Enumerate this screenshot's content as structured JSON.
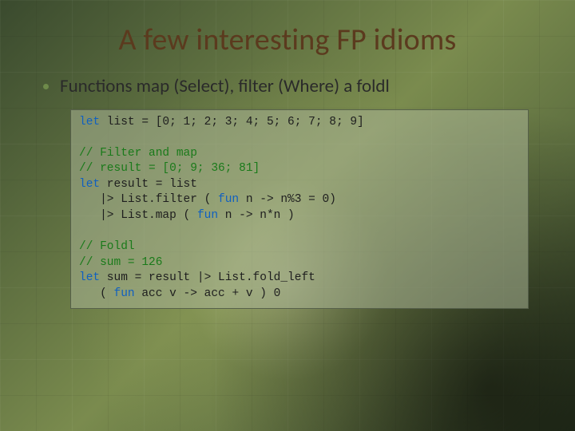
{
  "title": "A few interesting FP idioms",
  "bullet": "Functions map (Select), filter (Where) a foldl",
  "code": {
    "l1_pre": "let",
    "l1_post": " list = [0; 1; 2; 3; 4; 5; 6; 7; 8; 9]",
    "c1": "// Filter and map",
    "c2": "// result = [0; 9; 36; 81]",
    "l2_pre": "let",
    "l2_post": " result = list",
    "l3a": "   |> List.filter ( ",
    "l3b": "fun",
    "l3c": " n -> n%3 = 0)",
    "l4a": "   |> List.map ( ",
    "l4b": "fun",
    "l4c": " n -> n*n )",
    "c3": "// Foldl",
    "c4": "// sum = 126",
    "l5_pre": "let",
    "l5_post": " sum = result |> List.fold_left",
    "l6a": "   ( ",
    "l6b": "fun",
    "l6c": " acc v -> acc + v ) 0"
  }
}
